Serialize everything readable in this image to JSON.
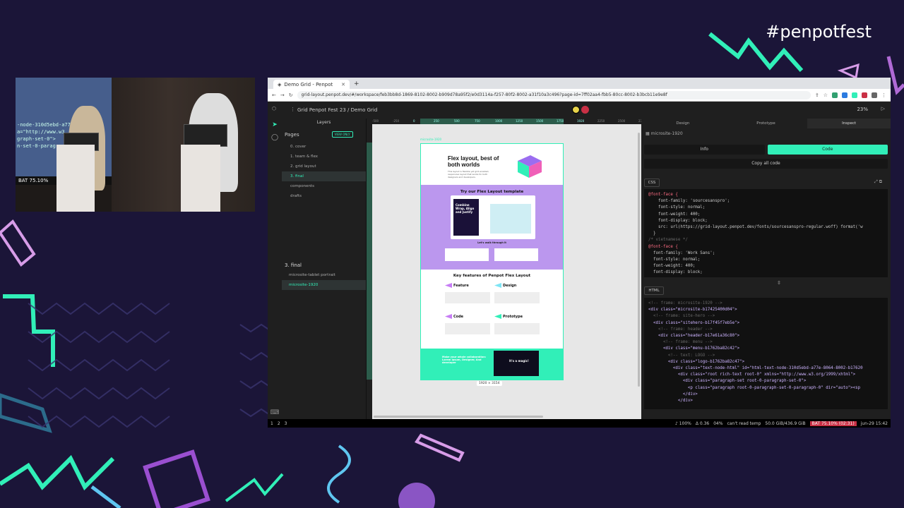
{
  "event": {
    "hashtag": "#penpotfest"
  },
  "camera": {
    "code_lines": [
      "-node-310d5ebd-a77e",
      "a=\"http://www.w3",
      "graph-set-0\">",
      "n-set-0-paragr"
    ],
    "status": "BAT 75.10%"
  },
  "browser": {
    "tab_title": "Demo Grid - Penpot",
    "url": "grid-layout.penpot.dev/#/workspace/feb3bb8d-1869-8102-8002-b909d78a95f2/e0d3114a-f257-80f2-8002-a31f10a3c496?page-id=7ff02aa4-fbb5-80cc-8002-b3bcb11e9e8f"
  },
  "workspace": {
    "breadcrumb": "Grid Penpot Fest 23 / Demo Grid",
    "zoom": "23%",
    "layers_tab": "Layers",
    "pages_title": "Pages",
    "view_only": "VIEW ONLY",
    "pages": [
      "0. cover",
      "1. team & flex",
      "2. grid layout",
      "3. final",
      "components",
      "drafts"
    ],
    "active_page_index": 3,
    "current_page": "3. final",
    "layers": [
      "microsite-tablet portrait",
      "microsite-1920"
    ]
  },
  "canvas": {
    "ruler_marks": [
      "-500",
      "-250",
      "0",
      "250",
      "500",
      "750",
      "1000",
      "1250",
      "1500",
      "1750",
      "1920",
      "2250",
      "2500",
      "2750"
    ],
    "board_label": "microsite-1920",
    "dims": "1920 × 3154",
    "hero_title": "Flex layout, best of both worlds",
    "hero_sub": "This layout is flexible yet grid-enabled, responsive layout that works for both designers and developers.",
    "template_title": "Try our Flex Layout template",
    "template_card": "Combine Wrap, Align and Justify",
    "walk": "Let's walk through it",
    "features_title": "Key features of Penpot Flex Layout",
    "features": [
      {
        "label": "Feature",
        "color": "#c77df5"
      },
      {
        "label": "Design",
        "color": "#7ee5f5"
      },
      {
        "label": "Code",
        "color": "#c77df5"
      },
      {
        "label": "Prototype",
        "color": "#31efb8"
      }
    ],
    "green_text": "Make your whole collaboration: Lorem ipsum, Designer, And developer",
    "video_text": "It's a magic!"
  },
  "inspect": {
    "tabs": [
      "Design",
      "Prototype",
      "Inspect"
    ],
    "board_name": "microsite-1920",
    "info_btn": "Info",
    "code_btn": "Code",
    "copy_all": "Copy all code",
    "css_label": "CSS",
    "html_label": "HTML",
    "css_lines": [
      "@font-face {",
      "    font-family: 'sourcesanspro';",
      "    font-style: normal;",
      "    font-weight: 400;",
      "    font-display: block;",
      "    src: url(https://grid-layout.penpot.dev/fonts/sourcesanspro-regular.woff) format('w",
      "  }",
      "/* vietnamese */",
      "@font-face {",
      "  font-family: 'Work Sans';",
      "  font-style: normal;",
      "  font-weight: 400;",
      "  font-display: block;"
    ],
    "html_lines": [
      "<!-- frame: microsite-1920 -->",
      "<div class=\"microsite-b17425400d04\">",
      "  <!-- frame: site-hero -->",
      "  <div class=\"sitehero-b17f45f7eb5e\">",
      "    <!-- frame: header -->",
      "    <div class=\"header-b17e61a36c80\">",
      "      <!-- frame: menu -->",
      "      <div class=\"menu-b1762ba82c42\">",
      "        <!-- text: LOGO -->",
      "        <div class=\"logo-b1762ba82c47\">",
      "          <div class=\"text-node-html\" id=\"html-text-node-310d5ebd-a77e-8064-8002-b17620",
      "            <div class=\"root rich-text root-0\" xmlns=\"http://www.w3.org/1999/xhtml\">",
      "              <div class=\"paragraph-set root-0-paragraph-set-0\">",
      "                <p class=\"paragraph root-0-paragraph-set-0-paragraph-0\" dir=\"auto\"><sp",
      "              </div>",
      "            </div>"
    ]
  },
  "statusbar": {
    "workspaces": [
      "1",
      "2",
      "3"
    ],
    "volume": "♪ 100%",
    "load": "Δ 0.36",
    "cpu": "04%",
    "temp": "can't read temp",
    "disk": "50.0 GiB/436.9 GiB",
    "battery": "BAT 75.10% (02:31)",
    "clock": "jun-29 15:42"
  }
}
